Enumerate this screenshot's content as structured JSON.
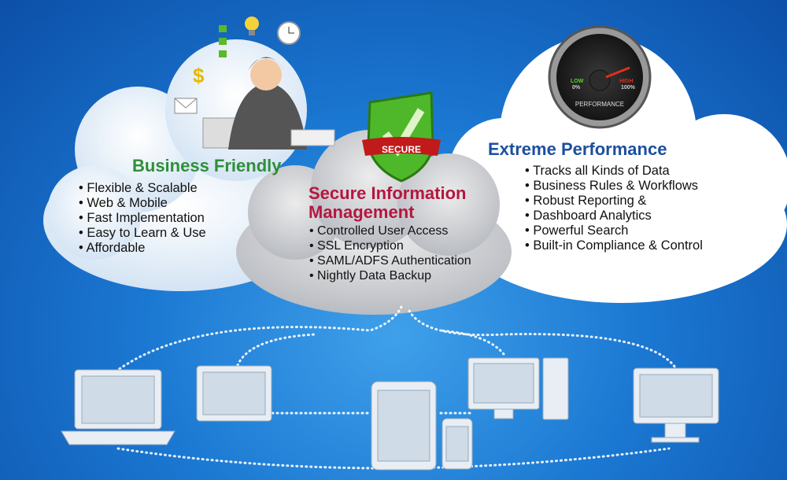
{
  "business": {
    "title": "Business Friendly",
    "items": [
      "Flexible & Scalable",
      "Web & Mobile",
      "Fast Implementation",
      "Easy to Learn & Use",
      "Affordable"
    ]
  },
  "secure": {
    "title_line1": "Secure Information",
    "title_line2": "Management",
    "badge": "SECURE",
    "items": [
      "Controlled User Access",
      "SSL Encryption",
      "SAML/ADFS Authentication",
      "Nightly Data Backup"
    ]
  },
  "performance": {
    "title": "Extreme Performance",
    "gauge": {
      "label": "PERFORMANCE",
      "low": "LOW",
      "low_pct": "0%",
      "high": "HIGH",
      "high_pct": "100%"
    },
    "items": [
      "Tracks all Kinds of Data",
      "Business Rules & Workflows",
      "Robust Reporting &",
      "Dashboard Analytics",
      "Powerful Search",
      "Built-in Compliance & Control"
    ]
  },
  "colors": {
    "business": "#2f8f3a",
    "secure": "#b5163f",
    "performance": "#1c4f9f",
    "background": "#1b78d2"
  },
  "icons": [
    "businesswoman-multitasking-icon",
    "dollar-icon",
    "lightbulb-icon",
    "clock-icon",
    "checklist-icon",
    "envelope-icon",
    "shield-check-icon",
    "performance-gauge-icon",
    "laptop-icon",
    "tablet-icon",
    "desktop-icon",
    "phone-icon",
    "monitor-icon"
  ]
}
